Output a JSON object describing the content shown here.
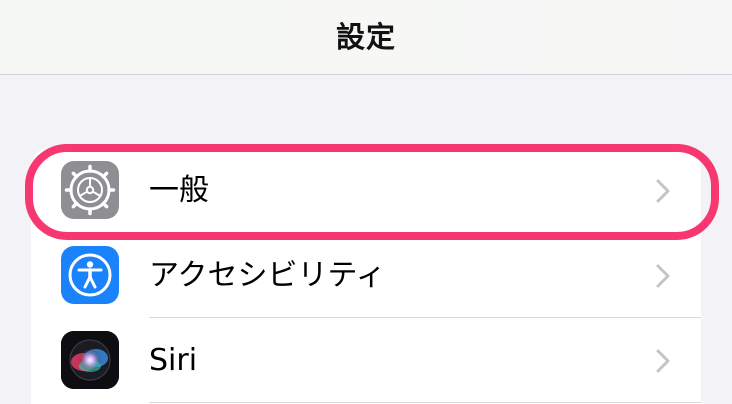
{
  "navbar": {
    "title": "設定"
  },
  "settings": {
    "items": [
      {
        "label": "一般",
        "icon": "gear-icon",
        "icon_bg": "#8e8e93"
      },
      {
        "label": "アクセシビリティ",
        "icon": "accessibility-icon",
        "icon_bg": "#1a82fb"
      },
      {
        "label": "Siri",
        "icon": "siri-icon",
        "icon_bg": "#111111"
      }
    ]
  },
  "highlight": {
    "color": "#f7376f",
    "target": "一般"
  },
  "colors": {
    "background": "#f2f2f7",
    "chevron": "#c4c4c7"
  }
}
